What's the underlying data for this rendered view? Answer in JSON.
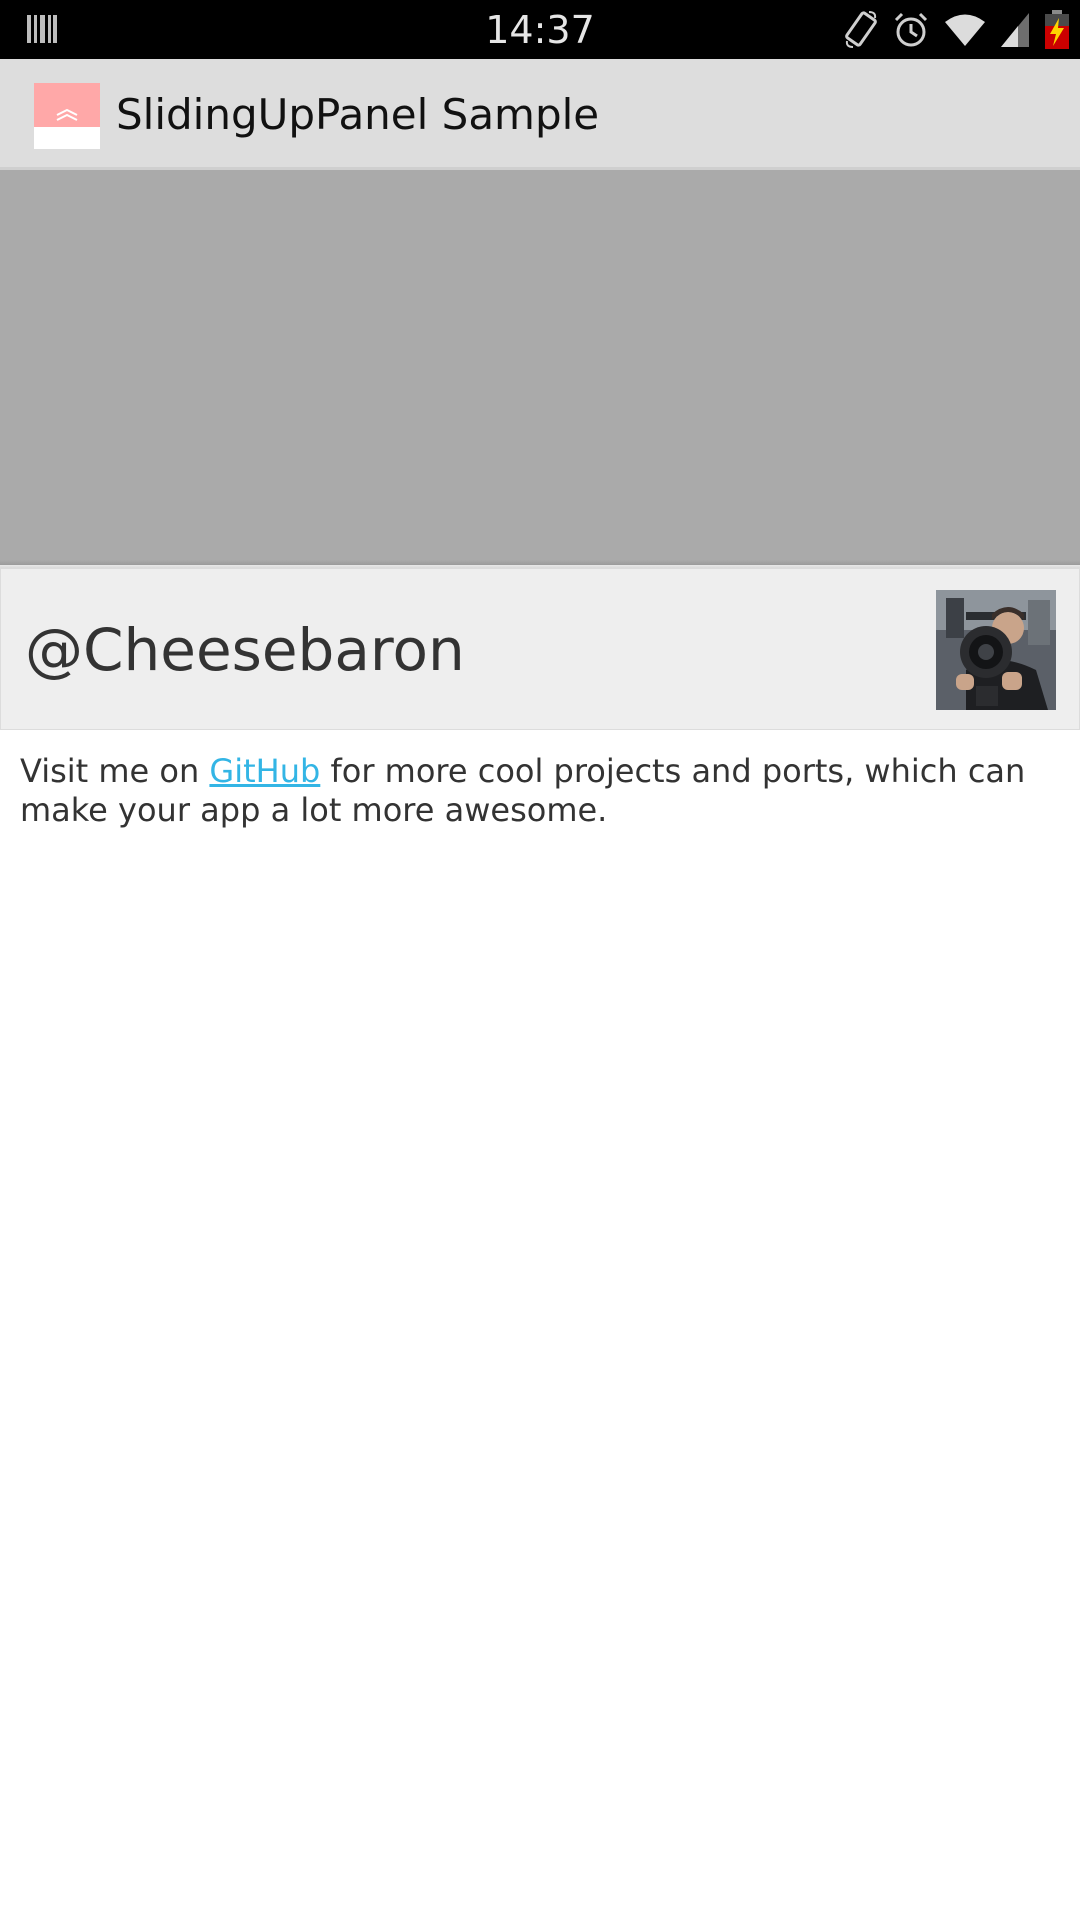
{
  "status_bar": {
    "time": "14:37",
    "icons": [
      "barcode-notification-icon",
      "screen-rotate-icon",
      "alarm-icon",
      "wifi-icon",
      "signal-icon",
      "battery-charging-icon"
    ],
    "battery_color": "#cc0000",
    "bolt_color": "#ffd400"
  },
  "action_bar": {
    "title": "SlidingUpPanel Sample",
    "icon": "sliding-panel-app-icon",
    "icon_color": "#ffa8a8"
  },
  "main_content": {
    "background_color": "#aaaaaa"
  },
  "panel": {
    "handle_text": "@Cheesebaron",
    "avatar": "profile-photo",
    "body_prefix": "Visit me on ",
    "link_text": "GitHub",
    "link_color": "#33b5e5",
    "body_suffix": " for more cool projects and ports, which can make your app a lot more awesome."
  }
}
